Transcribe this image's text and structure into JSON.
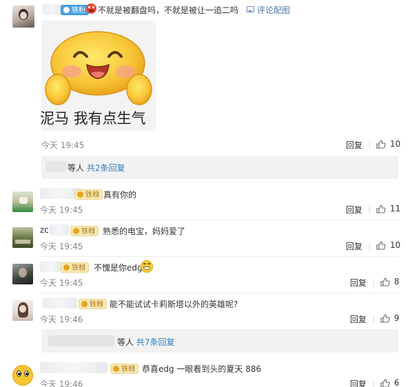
{
  "main_comment": {
    "badge": "铁粉",
    "text": "不就是被翻盘吗，不就是被让一追二吗",
    "pic_link": "评论配图",
    "sticker_caption": "泥马 我有点生气",
    "time": "今天 19:45",
    "reply": "回复",
    "likes": "10"
  },
  "more_replies_1": {
    "suffix": "等人",
    "link": "共2条回复"
  },
  "replies": [
    {
      "badge": "铁粉",
      "text": "真有你的",
      "time": "今天 19:45",
      "reply": "回复",
      "likes": "11"
    },
    {
      "name": "zc",
      "badge": "铁粉",
      "text": "熟悉的电宝，妈妈爱了",
      "time": "今天 19:45",
      "reply": "回复",
      "likes": "10"
    },
    {
      "badge": "铁粉",
      "text": "不愧是你edg",
      "time": "今天 19:45",
      "reply": "回复",
      "likes": "8"
    },
    {
      "badge": "铁粉",
      "text": "能不能试试卡莉斯塔以外的英雄呢?",
      "time": "今天 19:46",
      "reply": "回复",
      "likes": "9"
    }
  ],
  "more_replies_2": {
    "suffix": "等人",
    "link": "共7条回复"
  },
  "last_reply": {
    "badge": "铁粉",
    "text": "恭喜edg  一眼看到头的夏天 886",
    "time": "今天 19:46",
    "reply": "回复",
    "likes": "6"
  },
  "colors": {
    "link_blue": "#2e7ec4",
    "badge_gold": "#f7e9b6",
    "badge_blue": "#4aa3e8"
  }
}
